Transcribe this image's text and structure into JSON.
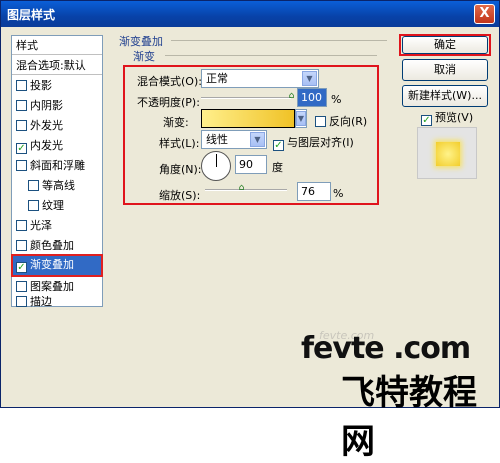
{
  "window": {
    "title": "图层样式",
    "close_label": "X"
  },
  "sidebar": {
    "header": "样式",
    "blend_options": "混合选项:默认",
    "items": [
      {
        "label": "投影",
        "checked": false
      },
      {
        "label": "内阴影",
        "checked": false
      },
      {
        "label": "外发光",
        "checked": false
      },
      {
        "label": "内发光",
        "checked": true
      },
      {
        "label": "斜面和浮雕",
        "checked": false
      },
      {
        "label": "等高线",
        "checked": false
      },
      {
        "label": "纹理",
        "checked": false
      },
      {
        "label": "光泽",
        "checked": false
      },
      {
        "label": "颜色叠加",
        "checked": false
      },
      {
        "label": "渐变叠加",
        "checked": true
      },
      {
        "label": "图案叠加",
        "checked": false
      },
      {
        "label": "描边",
        "checked": false
      }
    ]
  },
  "panel": {
    "section_title": "渐变叠加",
    "group_title": "渐变",
    "blend_mode_label": "混合模式(O):",
    "blend_mode_value": "正常",
    "opacity_label": "不透明度(P):",
    "opacity_value": "100",
    "percent": "%",
    "gradient_label": "渐变:",
    "reverse_label": "反向(R)",
    "style_label": "样式(L):",
    "style_value": "线性",
    "align_label": "与图层对齐(I)",
    "angle_label": "角度(N):",
    "angle_value": "90",
    "degree": "度",
    "scale_label": "缩放(S):",
    "scale_value": "76",
    "scale_percent": "%"
  },
  "buttons": {
    "ok": "确定",
    "cancel": "取消",
    "new_style": "新建样式(W)...",
    "preview_label": "预览(V)"
  },
  "watermark": {
    "line1": "fevte .com",
    "line2": "飞特教程网",
    "faint": "fevte.com"
  },
  "colors": {
    "accent_red": "#e0141c",
    "selected_blue": "#316ac5",
    "gradient_start": "#ffef8c",
    "gradient_end": "#f0c226"
  }
}
